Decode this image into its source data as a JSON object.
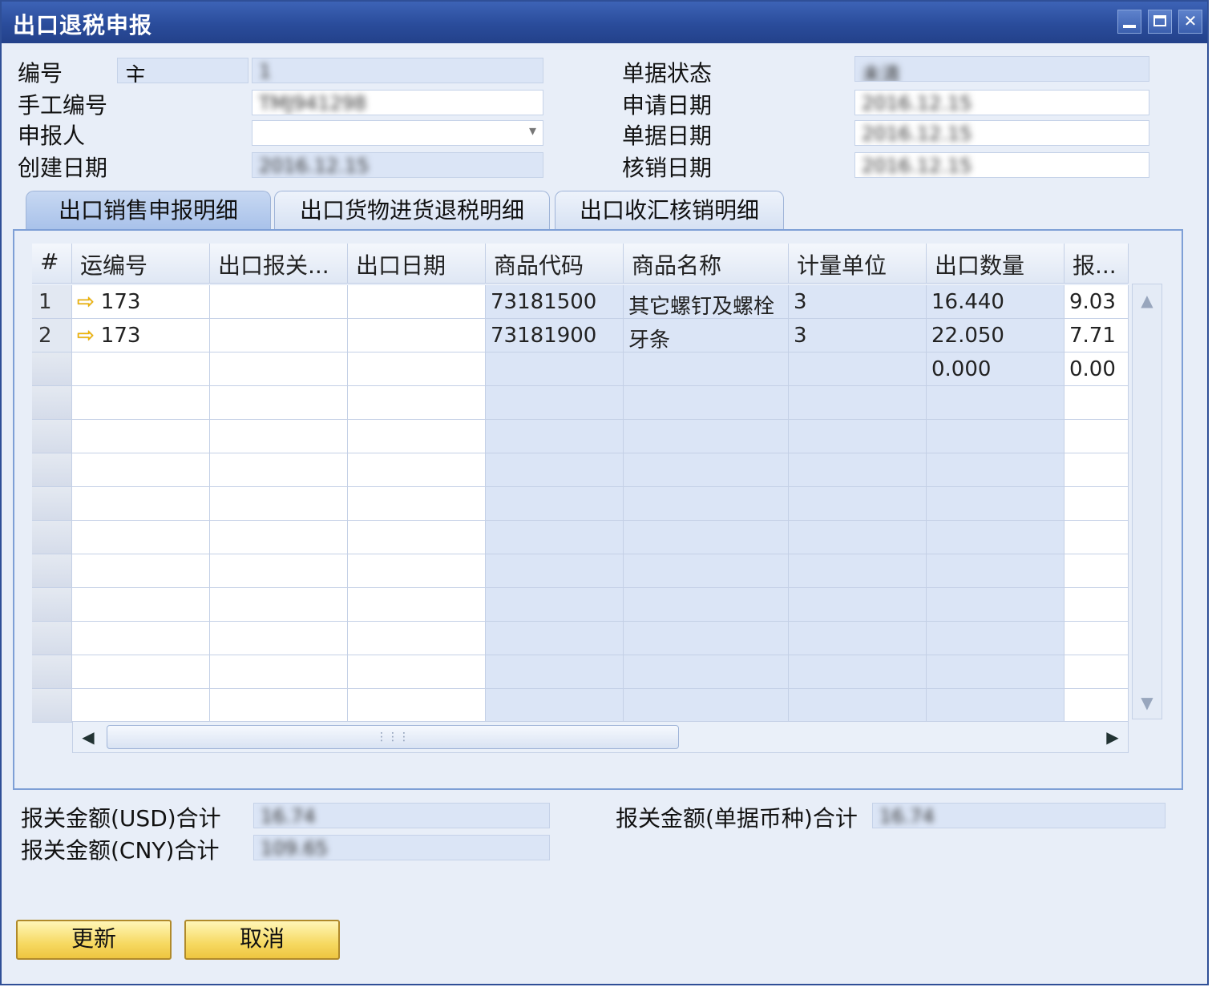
{
  "window": {
    "title": "出口退税申报"
  },
  "header": {
    "number_label": "编号",
    "series_value": "主",
    "number_value": "1",
    "manual_no_label": "手工编号",
    "manual_no_value": "TMJ941298",
    "declarant_label": "申报人",
    "declarant_value": "",
    "created_label": "创建日期",
    "created_value": "2016.12.15",
    "status_label": "单据状态",
    "status_value": "未清",
    "apply_date_label": "申请日期",
    "apply_date_value": "2016.12.15",
    "doc_date_label": "单据日期",
    "doc_date_value": "2016.12.15",
    "writeoff_date_label": "核销日期",
    "writeoff_date_value": "2016.12.15"
  },
  "tabs": [
    {
      "label": "出口销售申报明细",
      "active": true
    },
    {
      "label": "出口货物进货退税明细",
      "active": false
    },
    {
      "label": "出口收汇核销明细",
      "active": false
    }
  ],
  "table": {
    "columns": [
      "#",
      "运编号",
      "出口报关...",
      "出口日期",
      "商品代码",
      "商品名称",
      "计量单位",
      "出口数量",
      "报..."
    ],
    "rows": [
      {
        "n": "1",
        "ship_no": "173",
        "customs": "",
        "date": "",
        "code": "73181500",
        "name": "其它螺钉及螺栓",
        "unit": "3",
        "qty": "16.440",
        "amt": "9.03"
      },
      {
        "n": "2",
        "ship_no": "173",
        "customs": "",
        "date": "",
        "code": "73181900",
        "name": "牙条",
        "unit": "3",
        "qty": "22.050",
        "amt": "7.71"
      },
      {
        "n": "",
        "ship_no": "",
        "customs": "",
        "date": "",
        "code": "",
        "name": "",
        "unit": "",
        "qty": "0.000",
        "amt": "0.00"
      }
    ],
    "arrow_icon": "link-arrow-icon"
  },
  "totals": {
    "usd_label": "报关金额(USD)合计",
    "usd_value": "16.74",
    "cny_label": "报关金额(CNY)合计",
    "cny_value": "109.65",
    "doc_currency_label": "报关金额(单据币种)合计",
    "doc_currency_value": "16.74"
  },
  "buttons": {
    "update": "更新",
    "cancel": "取消"
  },
  "colors": {
    "titlebar": "#2a4c9b",
    "button": "#f6d962",
    "field": "#dbe5f6"
  }
}
